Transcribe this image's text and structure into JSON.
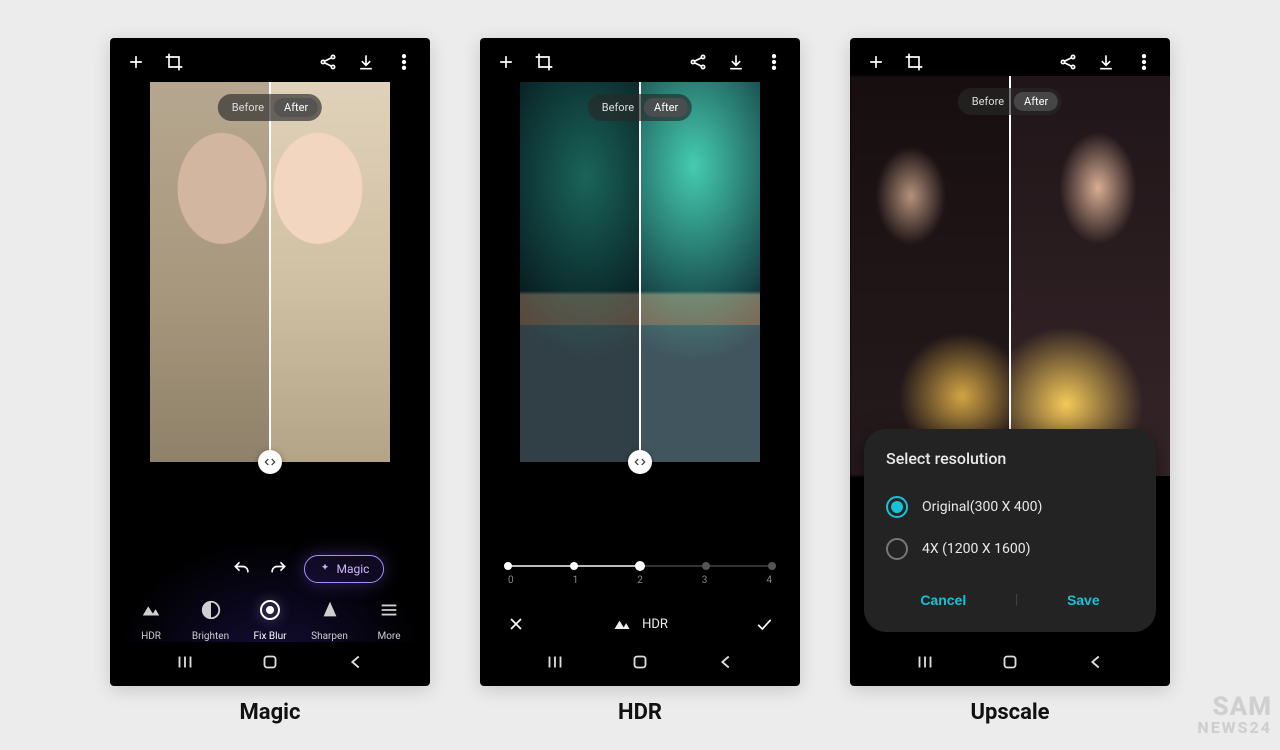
{
  "captions": {
    "magic": "Magic",
    "hdr": "HDR",
    "upscale": "Upscale"
  },
  "watermark": {
    "line1": "SAM",
    "line2": "NEWS24"
  },
  "common": {
    "before": "Before",
    "after": "After"
  },
  "phone1": {
    "magic_button": "Magic",
    "tools": {
      "hdr": "HDR",
      "brighten": "Brighten",
      "fix_blur": "Fix Blur",
      "sharpen": "Sharpen",
      "more": "More"
    }
  },
  "phone2": {
    "hdr_label": "HDR",
    "slider": {
      "labels": [
        "0",
        "1",
        "2",
        "3",
        "4"
      ],
      "value_index": 2
    }
  },
  "phone3": {
    "dialog": {
      "title": "Select resolution",
      "option_original": "Original(300 X 400)",
      "option_4x": "4X (1200 X 1600)",
      "cancel": "Cancel",
      "save": "Save"
    }
  }
}
